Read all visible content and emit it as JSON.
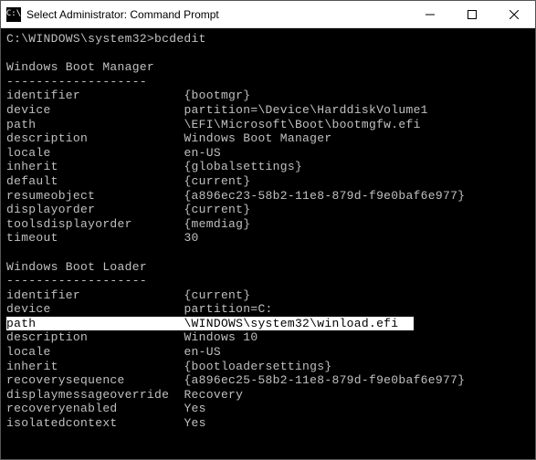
{
  "window": {
    "title": "Select Administrator: Command Prompt",
    "icon_label": "C:\\"
  },
  "prompt": {
    "path": "C:\\WINDOWS\\system32>",
    "command": "bcdedit"
  },
  "sections": {
    "boot_manager_header": "Windows Boot Manager",
    "boot_loader_header": "Windows Boot Loader",
    "divider": "-------------------"
  },
  "bm": {
    "identifier_k": "identifier",
    "identifier_v": "{bootmgr}",
    "device_k": "device",
    "device_v": "partition=\\Device\\HarddiskVolume1",
    "path_k": "path",
    "path_v": "\\EFI\\Microsoft\\Boot\\bootmgfw.efi",
    "description_k": "description",
    "description_v": "Windows Boot Manager",
    "locale_k": "locale",
    "locale_v": "en-US",
    "inherit_k": "inherit",
    "inherit_v": "{globalsettings}",
    "default_k": "default",
    "default_v": "{current}",
    "resumeobject_k": "resumeobject",
    "resumeobject_v": "{a896ec23-58b2-11e8-879d-f9e0baf6e977}",
    "displayorder_k": "displayorder",
    "displayorder_v": "{current}",
    "toolsdisplayorder_k": "toolsdisplayorder",
    "toolsdisplayorder_v": "{memdiag}",
    "timeout_k": "timeout",
    "timeout_v": "30"
  },
  "bl": {
    "identifier_k": "identifier",
    "identifier_v": "{current}",
    "device_k": "device",
    "device_v": "partition=C:",
    "path_k": "path",
    "path_v": "\\WINDOWS\\system32\\winload.efi",
    "description_k": "description",
    "description_v": "Windows 10",
    "locale_k": "locale",
    "locale_v": "en-US",
    "inherit_k": "inherit",
    "inherit_v": "{bootloadersettings}",
    "recoverysequence_k": "recoverysequence",
    "recoverysequence_v": "{a896ec25-58b2-11e8-879d-f9e0baf6e977}",
    "displaymessageoverride_k": "displaymessageoverride",
    "displaymessageoverride_v": "Recovery",
    "recoveryenabled_k": "recoveryenabled",
    "recoveryenabled_v": "Yes",
    "isolatedcontext_k": "isolatedcontext",
    "isolatedcontext_v": "Yes"
  }
}
